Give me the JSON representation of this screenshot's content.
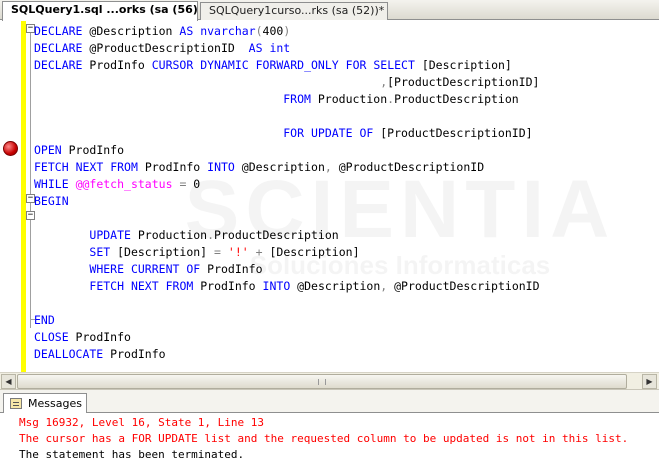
{
  "tabs": [
    {
      "label": "SQLQuery1.sql ...orks (sa (56))*",
      "active": true
    },
    {
      "label": "SQLQuery1curso...rks (sa (52))*",
      "active": false
    }
  ],
  "watermark": {
    "big": "SCIENTIA",
    "small": "Soluciones Informaticas"
  },
  "code_lines": [
    [
      {
        "t": "DECLARE",
        "c": "kw"
      },
      {
        "t": " @Description "
      },
      {
        "t": "AS",
        "c": "kw"
      },
      {
        "t": " "
      },
      {
        "t": "nvarchar",
        "c": "kw"
      },
      {
        "t": "(",
        "c": "op"
      },
      {
        "t": "400"
      },
      {
        "t": ")",
        "c": "op"
      }
    ],
    [
      {
        "t": "DECLARE",
        "c": "kw"
      },
      {
        "t": " @ProductDescriptionID  "
      },
      {
        "t": "AS",
        "c": "kw"
      },
      {
        "t": " "
      },
      {
        "t": "int",
        "c": "kw"
      }
    ],
    [
      {
        "t": "DECLARE",
        "c": "kw"
      },
      {
        "t": " ProdInfo "
      },
      {
        "t": "CURSOR",
        "c": "kw"
      },
      {
        "t": " "
      },
      {
        "t": "DYNAMIC",
        "c": "kw"
      },
      {
        "t": " "
      },
      {
        "t": "FORWARD_ONLY",
        "c": "kw"
      },
      {
        "t": " "
      },
      {
        "t": "FOR",
        "c": "kw"
      },
      {
        "t": " "
      },
      {
        "t": "SELECT",
        "c": "kw"
      },
      {
        "t": " [Description]"
      }
    ],
    [
      {
        "t": "                                                  "
      },
      {
        "t": ",",
        "c": "op"
      },
      {
        "t": "[ProductDescriptionID]"
      }
    ],
    [
      {
        "t": "                                    "
      },
      {
        "t": "FROM",
        "c": "kw"
      },
      {
        "t": " Production"
      },
      {
        "t": ".",
        "c": "op"
      },
      {
        "t": "ProductDescription"
      }
    ],
    [],
    [
      {
        "t": "                                    "
      },
      {
        "t": "FOR",
        "c": "kw"
      },
      {
        "t": " "
      },
      {
        "t": "UPDATE",
        "c": "kw"
      },
      {
        "t": " "
      },
      {
        "t": "OF",
        "c": "kw"
      },
      {
        "t": " [ProductDescriptionID]"
      }
    ],
    [
      {
        "t": "OPEN",
        "c": "kw"
      },
      {
        "t": " ProdInfo"
      }
    ],
    [
      {
        "t": "FETCH",
        "c": "kw"
      },
      {
        "t": " "
      },
      {
        "t": "NEXT",
        "c": "kw"
      },
      {
        "t": " "
      },
      {
        "t": "FROM",
        "c": "kw"
      },
      {
        "t": " ProdInfo "
      },
      {
        "t": "INTO",
        "c": "kw"
      },
      {
        "t": " @Description"
      },
      {
        "t": ",",
        "c": "op"
      },
      {
        "t": " @ProductDescriptionID"
      }
    ],
    [
      {
        "t": "WHILE",
        "c": "kw"
      },
      {
        "t": " "
      },
      {
        "t": "@@fetch_status",
        "c": "fn"
      },
      {
        "t": " "
      },
      {
        "t": "=",
        "c": "op"
      },
      {
        "t": " 0"
      }
    ],
    [
      {
        "t": "BEGIN",
        "c": "kw"
      }
    ],
    [],
    [
      {
        "t": "        "
      },
      {
        "t": "UPDATE",
        "c": "kw"
      },
      {
        "t": " Production"
      },
      {
        "t": ".",
        "c": "op"
      },
      {
        "t": "ProductDescription"
      }
    ],
    [
      {
        "t": "        "
      },
      {
        "t": "SET",
        "c": "kw"
      },
      {
        "t": " [Description] "
      },
      {
        "t": "=",
        "c": "op"
      },
      {
        "t": " "
      },
      {
        "t": "'!'",
        "c": "str"
      },
      {
        "t": " "
      },
      {
        "t": "+",
        "c": "op"
      },
      {
        "t": " [Description]"
      }
    ],
    [
      {
        "t": "        "
      },
      {
        "t": "WHERE",
        "c": "kw"
      },
      {
        "t": " "
      },
      {
        "t": "CURRENT",
        "c": "kw"
      },
      {
        "t": " "
      },
      {
        "t": "OF",
        "c": "kw"
      },
      {
        "t": " ProdInfo"
      }
    ],
    [
      {
        "t": "        "
      },
      {
        "t": "FETCH",
        "c": "kw"
      },
      {
        "t": " "
      },
      {
        "t": "NEXT",
        "c": "kw"
      },
      {
        "t": " "
      },
      {
        "t": "FROM",
        "c": "kw"
      },
      {
        "t": " ProdInfo "
      },
      {
        "t": "INTO",
        "c": "kw"
      },
      {
        "t": " @Description"
      },
      {
        "t": ",",
        "c": "op"
      },
      {
        "t": " @ProductDescriptionID"
      }
    ],
    [],
    [
      {
        "t": "END",
        "c": "kw"
      }
    ],
    [
      {
        "t": "CLOSE",
        "c": "kw"
      },
      {
        "t": " ProdInfo"
      }
    ],
    [
      {
        "t": "DEALLOCATE",
        "c": "kw"
      },
      {
        "t": " ProdInfo"
      }
    ]
  ],
  "results": {
    "tab_label": "Messages",
    "lines": [
      {
        "text": "Msg 16932, Level 16, State 1, Line 13",
        "kind": "err"
      },
      {
        "text": "The cursor has a FOR UPDATE list and the requested column to be updated is not in this list.",
        "kind": "err"
      },
      {
        "text": "The statement has been terminated.",
        "kind": "ok"
      }
    ]
  },
  "scrollbar": {
    "left_arrow": "◀",
    "right_arrow": "▶"
  },
  "colors": {
    "keyword": "#0000ff",
    "system_function": "#ff00ff",
    "operator": "#808080",
    "string": "#ff0000",
    "error": "#ff0000",
    "change_bar": "#ffff00",
    "breakpoint": "#c60000"
  }
}
